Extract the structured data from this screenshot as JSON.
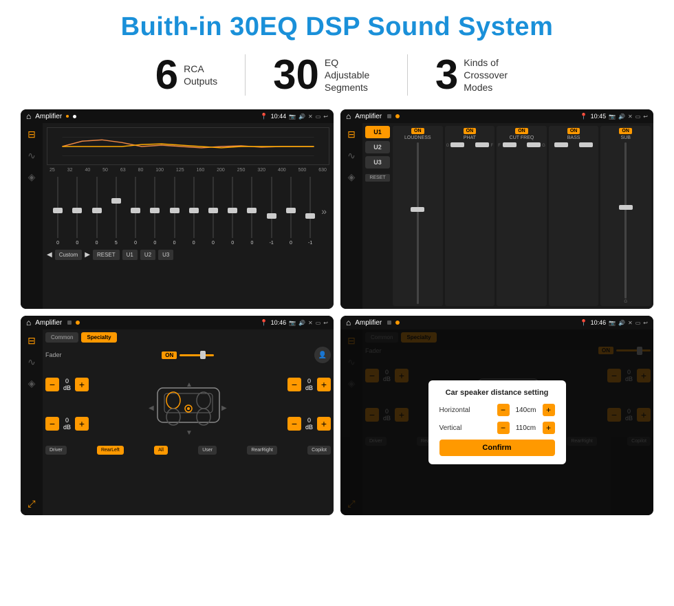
{
  "page": {
    "title": "Buith-in 30EQ DSP Sound System",
    "stats": [
      {
        "number": "6",
        "label": "RCA\nOutputs"
      },
      {
        "number": "30",
        "label": "EQ Adjustable\nSegments"
      },
      {
        "number": "3",
        "label": "Kinds of\nCrossover Modes"
      }
    ]
  },
  "screens": {
    "eq": {
      "title": "Amplifier",
      "time": "10:44",
      "freq_labels": [
        "25",
        "32",
        "40",
        "50",
        "63",
        "80",
        "100",
        "125",
        "160",
        "200",
        "250",
        "320",
        "400",
        "500",
        "630"
      ],
      "slider_values": [
        "0",
        "0",
        "0",
        "5",
        "0",
        "0",
        "0",
        "0",
        "0",
        "0",
        "0",
        "-1",
        "0",
        "-1"
      ],
      "preset_label": "Custom",
      "buttons": [
        "RESET",
        "U1",
        "U2",
        "U3"
      ]
    },
    "crossover": {
      "title": "Amplifier",
      "time": "10:45",
      "presets": [
        "U1",
        "U2",
        "U3"
      ],
      "controls": [
        "LOUDNESS",
        "PHAT",
        "CUT FREQ",
        "BASS",
        "SUB"
      ],
      "reset_label": "RESET"
    },
    "fader": {
      "title": "Amplifier",
      "time": "10:46",
      "tabs": [
        "Common",
        "Specialty"
      ],
      "fader_label": "Fader",
      "on_label": "ON",
      "vol_rows": [
        {
          "value": "0 dB"
        },
        {
          "value": "0 dB"
        },
        {
          "value": "0 dB"
        },
        {
          "value": "0 dB"
        }
      ],
      "bottom_buttons": [
        "Driver",
        "RearLeft",
        "All",
        "User",
        "RearRight",
        "Copilot"
      ]
    },
    "dialog": {
      "title": "Amplifier",
      "time": "10:46",
      "dialog_title": "Car speaker distance setting",
      "rows": [
        {
          "label": "Horizontal",
          "value": "140cm"
        },
        {
          "label": "Vertical",
          "value": "110cm"
        }
      ],
      "confirm_label": "Confirm",
      "bottom_buttons": [
        "Driver",
        "RearLeft",
        "All",
        "User",
        "RearRight",
        "Copilot"
      ]
    }
  },
  "icons": {
    "home": "⌂",
    "eq_icon": "⊞",
    "wave_icon": "∿",
    "speaker_icon": "◈",
    "expand_icon": "⤢",
    "location": "📍",
    "photo": "📷",
    "volume": "🔊",
    "close_x": "✕",
    "minus": "—",
    "menu": "☰",
    "back": "↩",
    "arrow_right": "▶",
    "arrow_left": "◀",
    "arrow_up": "▲",
    "arrow_down": "▼",
    "user": "👤",
    "plus": "+",
    "minus_sign": "−"
  }
}
